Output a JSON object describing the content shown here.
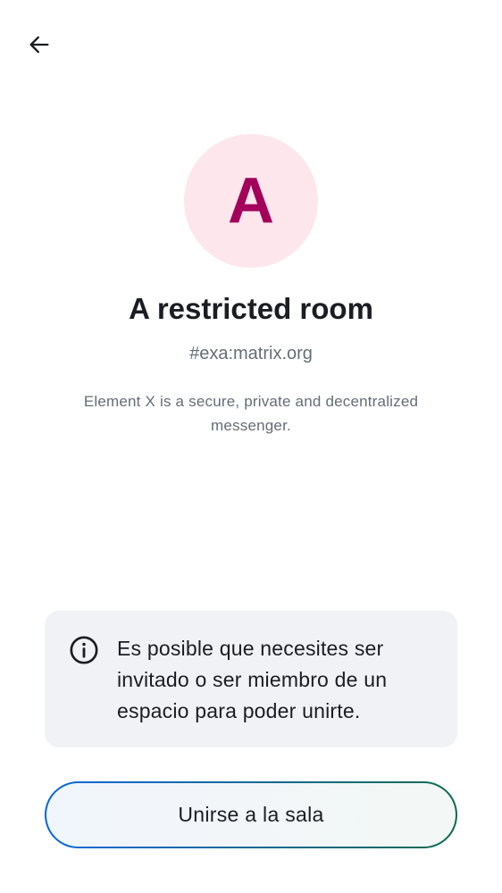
{
  "nav": {
    "back_icon": "arrow-left-icon"
  },
  "room": {
    "avatar_letter": "A",
    "avatar_bg_color": "#fde6ec",
    "avatar_fg_color": "#a3005c",
    "name": "A restricted room",
    "alias": "#exa:matrix.org",
    "topic": "Element X is a secure, private and decentralized messenger."
  },
  "notice": {
    "icon": "info-icon",
    "text": "Es posible que necesites ser invitado o ser miembro de un espacio para poder unirte."
  },
  "actions": {
    "join_label": "Unirse a la sala",
    "gradient_start": "#0467dd",
    "gradient_end": "#0c6b4f"
  }
}
